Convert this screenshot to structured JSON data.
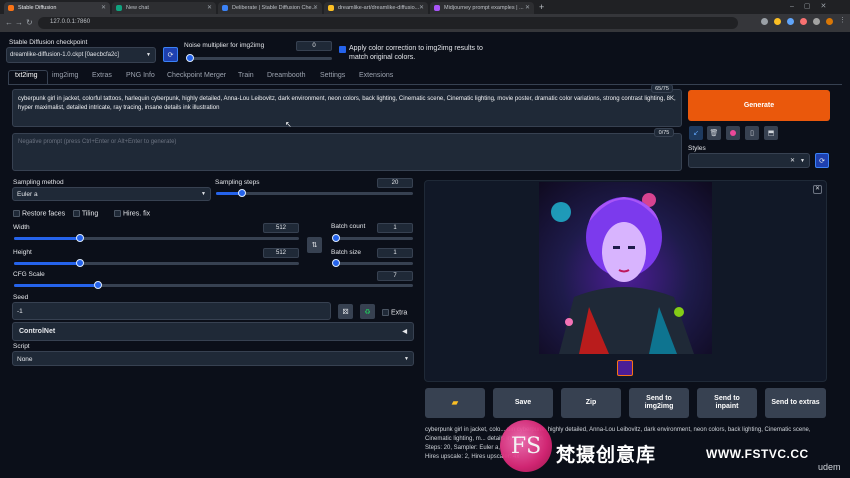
{
  "browser": {
    "tabs": [
      {
        "title": "Stable Diffusion",
        "color": "#f97316"
      },
      {
        "title": "New chat",
        "color": "#10a37f"
      },
      {
        "title": "Deliberate | Stable Diffusion Che...",
        "color": "#3b82f6"
      },
      {
        "title": "dreamlike-art/dreamlike-diffusio...",
        "color": "#fbbf24"
      },
      {
        "title": "Midjourney prompt examples | ...",
        "color": "#a855f7"
      }
    ],
    "new_tab": "+",
    "url": "127.0.0.1:7860"
  },
  "header": {
    "checkpoint_label": "Stable Diffusion checkpoint",
    "checkpoint_value": "dreamlike-diffusion-1.0.ckpt [0aecbcfa2c]",
    "noise_label": "Noise multiplier for img2img",
    "noise_value": "0",
    "noise_fraction": 0,
    "color_correction_label": "Apply color correction to img2img results to match original colors.",
    "color_correction_checked": true
  },
  "tabs": [
    "txt2img",
    "img2img",
    "Extras",
    "PNG Info",
    "Checkpoint Merger",
    "Train",
    "Dreambooth",
    "Settings",
    "Extensions"
  ],
  "prompt": {
    "text": "cyberpunk girl in jacket, colorful tattoos, harlequin cyberpunk, highly detailed, Anna-Lou Leibovitz, dark environment, neon colors, back lighting, Cinematic scene, Cinematic lighting, movie poster, dramatic color variations, strong contrast lighting, 8K, hyper maximalist, detailed intricate, ray tracing, insane details ink illustration",
    "token_count": "65/75"
  },
  "negative_prompt": {
    "placeholder": "Negative prompt (press Ctrl+Enter or Alt+Enter to generate)",
    "token_count": "0/75"
  },
  "generate_label": "Generate",
  "styles_label": "Styles",
  "sampling": {
    "method_label": "Sampling method",
    "method_value": "Euler a",
    "steps_label": "Sampling steps",
    "steps_value": "20",
    "steps_fraction": 0.13
  },
  "options": {
    "restore_faces": "Restore faces",
    "tiling": "Tiling",
    "hires_fix": "Hires. fix"
  },
  "size": {
    "width_label": "Width",
    "width_value": "512",
    "width_fraction": 0.23,
    "height_label": "Height",
    "height_value": "512",
    "height_fraction": 0.23,
    "batch_count_label": "Batch count",
    "batch_count_value": "1",
    "batch_count_fraction": 0,
    "batch_size_label": "Batch size",
    "batch_size_value": "1",
    "batch_size_fraction": 0,
    "swap_icon": "swap-icon"
  },
  "cfg": {
    "label": "CFG Scale",
    "value": "7",
    "fraction": 0.21
  },
  "seed": {
    "label": "Seed",
    "value": "-1",
    "extra_label": "Extra"
  },
  "controlnet_label": "ControlNet",
  "script": {
    "label": "Script",
    "value": "None"
  },
  "output_actions": [
    {
      "label": "",
      "icon": "folder-icon"
    },
    {
      "label": "Save"
    },
    {
      "label": "Zip"
    },
    {
      "label": "Send to img2img"
    },
    {
      "label": "Send to inpaint"
    },
    {
      "label": "Send to extras"
    }
  ],
  "info": {
    "line1": "cyberpunk girl in jacket, colo... uin cyberpunk, highly detailed, Anna-Lou Leibovitz, dark environment, neon colors, back lighting, Cinematic scene, Cinematic lighting, m... details ink illustration",
    "line2": "Steps: 20, Sampler: Euler a,",
    "line3": "Hires upscale: 2, Hires upscaler: 4x"
  },
  "watermark": {
    "brand": "梵摄创意库",
    "url": "WWW.FSTVC.CC",
    "logo_letters": "FS",
    "corner": "udem"
  }
}
